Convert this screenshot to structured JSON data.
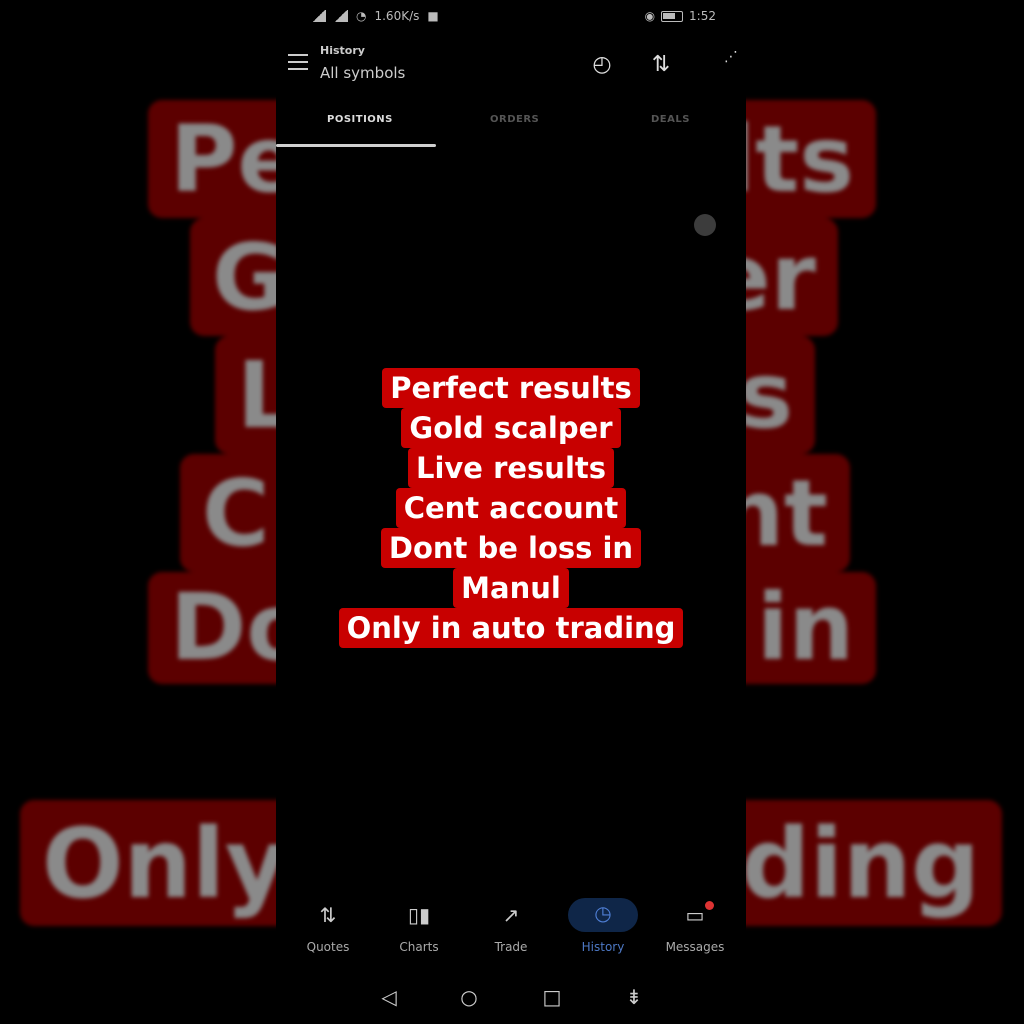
{
  "status_bar": {
    "network_speed": "1.60K/s",
    "time": "1:52"
  },
  "header": {
    "title": "History",
    "subtitle": "All symbols"
  },
  "tabs": [
    {
      "label": "POSITIONS",
      "active": true
    },
    {
      "label": "ORDERS",
      "active": false
    },
    {
      "label": "DEALS",
      "active": false
    }
  ],
  "caption": {
    "lines": [
      "Perfect results",
      "Gold scalper",
      "Live results",
      "Cent account",
      "Dont be loss in",
      "Manul",
      "Only in auto trading"
    ]
  },
  "background_text": {
    "line1_left": "Pe",
    "line1_right": "lts",
    "line2_left": "G",
    "line2_right": "er",
    "line3_left": "L",
    "line3_right": "s",
    "line4_left": "C",
    "line4_right": "nt",
    "line5_left": "Do",
    "line5_right": "in",
    "line6_left": "Only",
    "line6_right": "ading"
  },
  "bottom_nav": [
    {
      "label": "Quotes",
      "icon": "quotes-icon"
    },
    {
      "label": "Charts",
      "icon": "charts-icon"
    },
    {
      "label": "Trade",
      "icon": "trade-icon"
    },
    {
      "label": "History",
      "icon": "history-icon",
      "active": true
    },
    {
      "label": "Messages",
      "icon": "messages-icon"
    }
  ],
  "colors": {
    "caption_bg": "#c80000",
    "accent": "#4d78c4"
  }
}
